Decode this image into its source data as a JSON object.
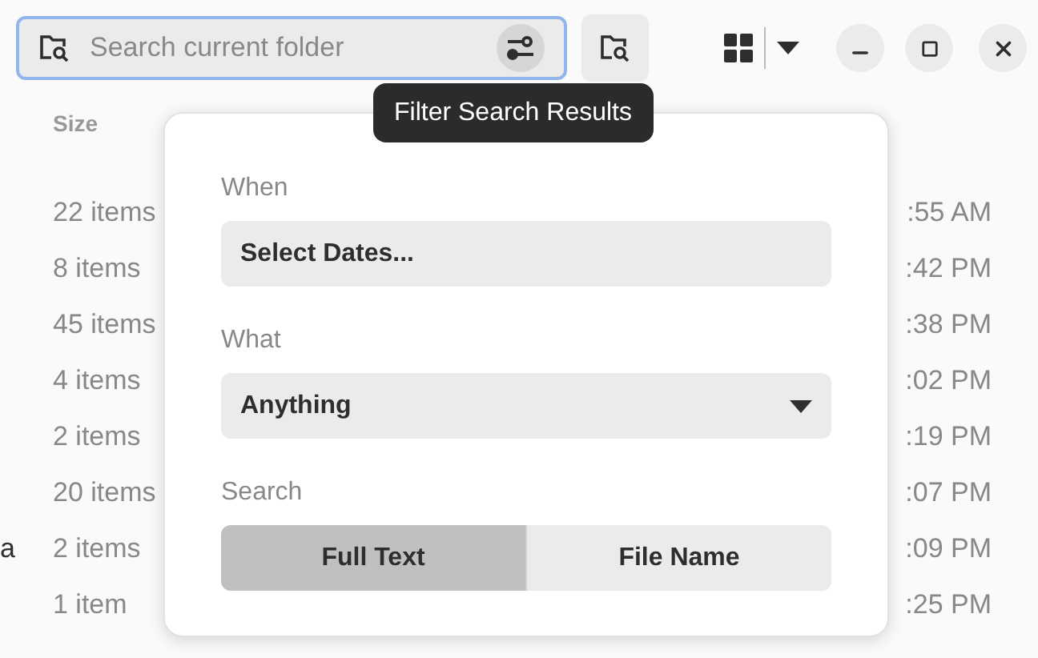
{
  "search": {
    "placeholder": "Search current folder",
    "focused": true
  },
  "tooltip": {
    "text": "Filter Search Results"
  },
  "list": {
    "columns": [
      "Size"
    ],
    "rows": [
      {
        "size": "22 items",
        "modified": ":55 AM"
      },
      {
        "size": "8 items",
        "modified": ":42 PM"
      },
      {
        "size": "45 items",
        "modified": ":38 PM"
      },
      {
        "size": "4 items",
        "modified": ":02 PM"
      },
      {
        "size": "2 items",
        "modified": ":19 PM"
      },
      {
        "size": "20 items",
        "modified": ":07 PM"
      },
      {
        "name": "a",
        "size": "2 items",
        "modified": ":09 PM"
      },
      {
        "size": "1 item",
        "modified": ":25 PM"
      }
    ]
  },
  "filter": {
    "when_label": "When",
    "dates_button": "Select Dates...",
    "what_label": "What",
    "what_value": "Anything",
    "search_label": "Search",
    "segments": [
      {
        "label": "Full Text",
        "selected": true
      },
      {
        "label": "File Name",
        "selected": false
      }
    ]
  }
}
